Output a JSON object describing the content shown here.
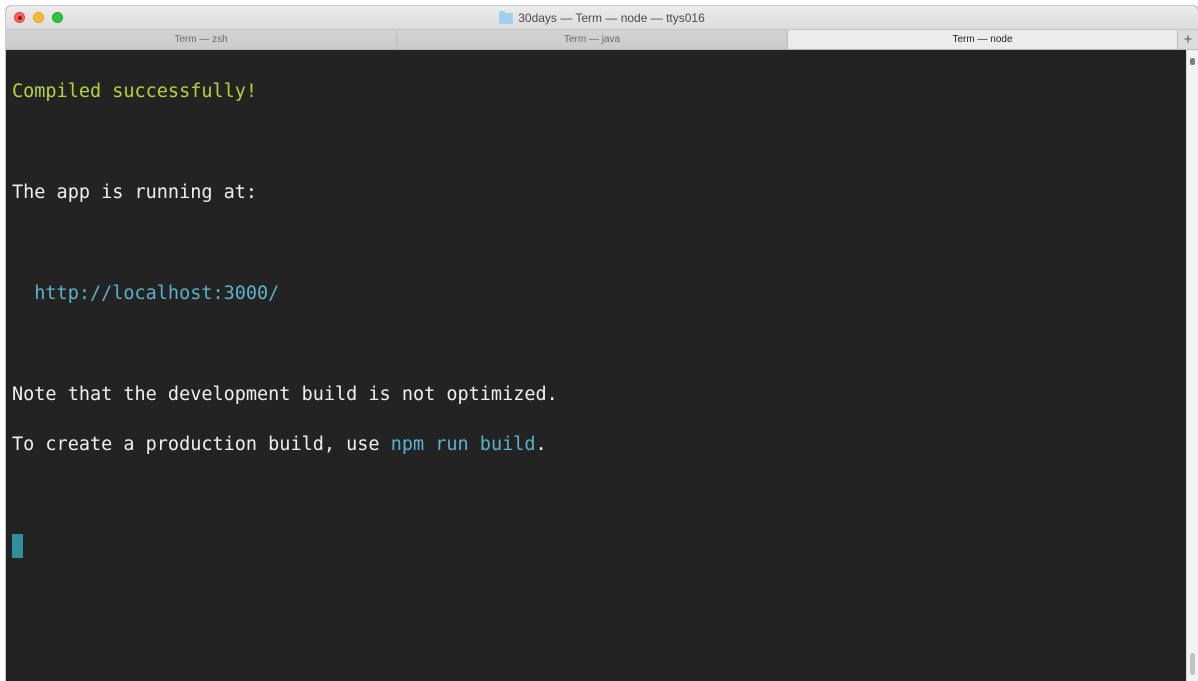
{
  "window": {
    "title": "30days — Term — node — ttys016"
  },
  "tabs": [
    {
      "label": "Term — zsh",
      "active": false
    },
    {
      "label": "Term — java",
      "active": false
    },
    {
      "label": "Term — node",
      "active": true
    }
  ],
  "tab_add_label": "+",
  "terminal": {
    "line_compiled": "Compiled successfully!",
    "line_running": "The app is running at:",
    "url_indent": "  ",
    "url": "http://localhost:3000/",
    "line_note": "Note that the development build is not optimized.",
    "line_create_prefix": "To create a production build, use ",
    "line_create_cmd": "npm run build",
    "line_create_suffix": "."
  },
  "colors": {
    "terminal_background": "#232323",
    "text": "#f0f0f0",
    "success_green": "#b6d334",
    "accent_cyan": "#59b3c9",
    "cursor": "#2e8f9d"
  },
  "icons": {
    "title_folder": "folder-icon",
    "close": "close-icon",
    "minimize": "minimize-icon",
    "zoom": "zoom-icon",
    "add_tab": "plus-icon"
  }
}
